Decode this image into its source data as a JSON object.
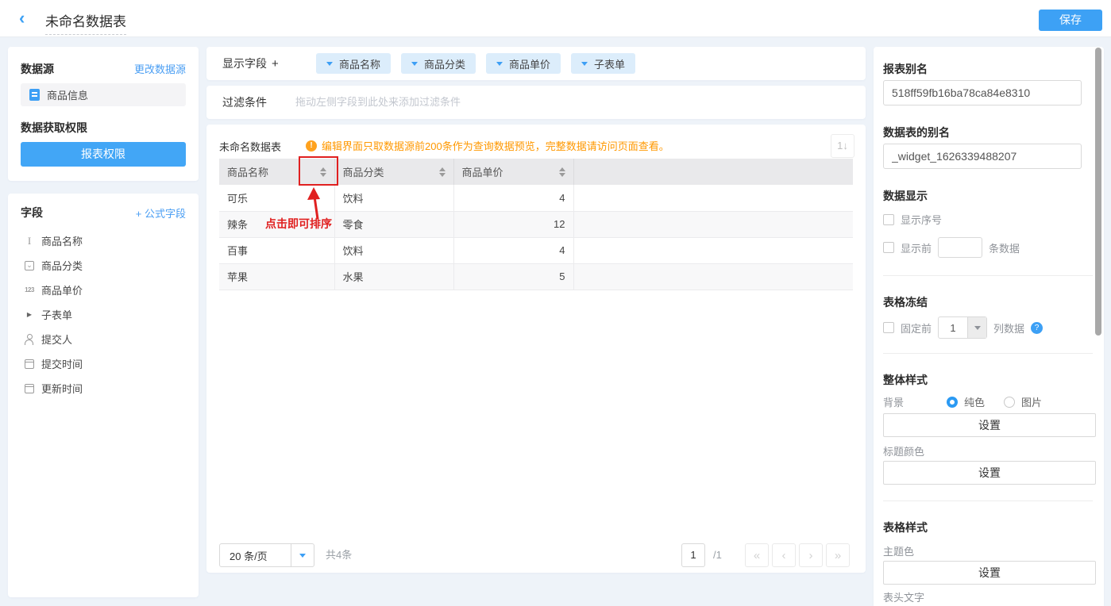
{
  "topbar": {
    "title": "未命名数据表",
    "back_icon": "‹",
    "save_label": "保存"
  },
  "colors": {
    "primary": "#3da1f5",
    "warning_orange": "#ff9800",
    "annotation_red": "#e02020",
    "chip_bg": "#dcedfb"
  },
  "left": {
    "datasource": {
      "title": "数据源",
      "change_link": "更改数据源",
      "source_name": "商品信息"
    },
    "permission": {
      "title": "数据获取权限",
      "button_label": "报表权限"
    },
    "fields": {
      "title": "字段",
      "add_formula_label": "+ 公式字段",
      "items": [
        {
          "icon": "text-field-icon",
          "label": "商品名称"
        },
        {
          "icon": "select-field-icon",
          "label": "商品分类"
        },
        {
          "icon": "number-field-icon",
          "label": "商品单价"
        },
        {
          "icon": "subform-expand-icon",
          "label": "子表单"
        },
        {
          "icon": "user-icon",
          "label": "提交人"
        },
        {
          "icon": "calendar-icon",
          "label": "提交时间"
        },
        {
          "icon": "calendar-icon",
          "label": "更新时间"
        }
      ]
    }
  },
  "main": {
    "display_fields": {
      "label": "显示字段",
      "add_icon": "+",
      "chips": [
        "商品名称",
        "商品分类",
        "商品单价",
        "子表单"
      ]
    },
    "filter": {
      "label": "过滤条件",
      "placeholder": "拖动左侧字段到此处来添加过滤条件"
    },
    "preview": {
      "title": "未命名数据表",
      "warning_icon": "!",
      "warning_text": "编辑界面只取数据源前200条作为查询数据预览，完整数据请访问页面查看。",
      "sort_tool_icon": "1↓",
      "annotation_text": "点击即可排序",
      "table": {
        "columns": [
          "商品名称",
          "商品分类",
          "商品单价",
          ""
        ],
        "rows": [
          [
            "可乐",
            "饮料",
            "4"
          ],
          [
            "辣条",
            "零食",
            "12"
          ],
          [
            "百事",
            "饮料",
            "4"
          ],
          [
            "苹果",
            "水果",
            "5"
          ]
        ]
      },
      "pagination": {
        "page_size": "20 条/页",
        "total": "共4条",
        "current_page": "1",
        "page_count": "/1",
        "icons": {
          "first": "«",
          "prev": "‹",
          "next": "›",
          "last": "»"
        }
      }
    }
  },
  "right": {
    "report_alias": {
      "label": "报表别名",
      "value": "518ff59fb16ba78ca84e8310"
    },
    "table_alias": {
      "label": "数据表的别名",
      "value": "_widget_1626339488207"
    },
    "data_display": {
      "title": "数据显示",
      "show_index_label": "显示序号",
      "show_first_label": "显示前",
      "suffix_label": "条数据",
      "limit_value": ""
    },
    "freeze": {
      "title": "表格冻结",
      "prefix_label": "固定前",
      "col_value": "1",
      "suffix_label": "列数据",
      "help_icon": "?"
    },
    "overall_style": {
      "title": "整体样式",
      "bg_label": "背景",
      "solid_label": "纯色",
      "image_label": "图片",
      "set_label": "设置",
      "title_color_label": "标题颜色"
    },
    "table_style": {
      "title": "表格样式",
      "theme_label": "主题色",
      "set_label": "设置",
      "header_text_label": "表头文字"
    }
  }
}
